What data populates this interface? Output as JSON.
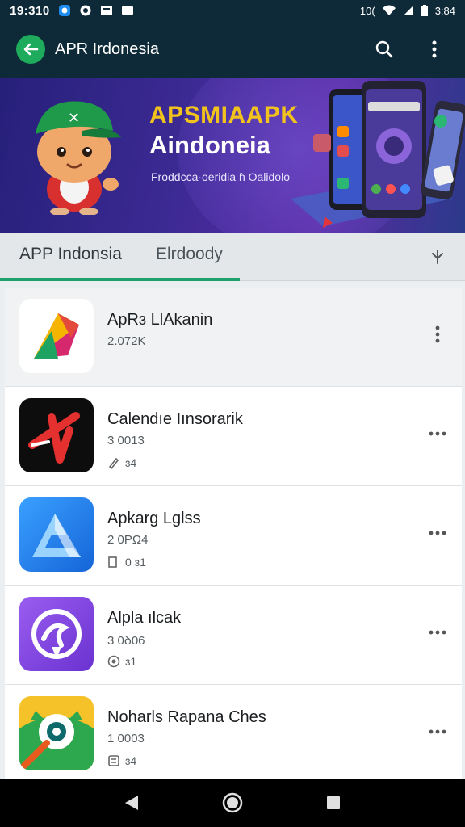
{
  "status_bar": {
    "time": "19:310",
    "signal_text": "10(",
    "battery_text": "3:84",
    "icons": [
      "notification-icon",
      "notification-icon",
      "message-icon",
      "square-icon",
      "wifi-icon",
      "signal-icon",
      "battery-icon"
    ]
  },
  "app_bar": {
    "title": "APR Irdonesia",
    "back_icon": "arrow-left-icon",
    "search_icon": "search-icon",
    "menu_icon": "more-vertical-icon",
    "accent": "#1fab5c",
    "background": "#0e2a38"
  },
  "banner": {
    "headline": "APSMIAAPK",
    "subheadline": "Aindoneia",
    "caption": "Froddcca·oeridia  ɦ Oalidolo",
    "headline_color": "#f2c31c"
  },
  "tabs": {
    "items": [
      {
        "label": "APP Indonsia",
        "selected": true
      },
      {
        "label": "Elrdoody",
        "selected": false
      }
    ],
    "more_icon": "sort-icon",
    "indicator_color": "#1fa06a"
  },
  "apps": [
    {
      "name": "ApRɜ LlAkanin",
      "size": "2.072K",
      "meta": "",
      "icon": "play-logo-icon",
      "more": "more-vertical-icon"
    },
    {
      "name": "Calendıe Iınsorarik",
      "size": "3 0013",
      "meta": "ɜ4",
      "meta_icon": "pencil-icon",
      "icon": "red-x-logo-icon",
      "more": "more-horizontal-icon"
    },
    {
      "name": "Apkarg Lglss",
      "size": "2 0PΩ4",
      "meta": "0 ɜ1",
      "meta_icon": "box-icon",
      "icon": "blue-a-logo-icon",
      "more": "more-horizontal-icon"
    },
    {
      "name": "Alpla ılcak",
      "size": "3 0ꝺ06",
      "meta": "ɜ1",
      "meta_icon": "target-icon",
      "icon": "purple-swirl-logo-icon",
      "more": "more-horizontal-icon"
    },
    {
      "name": "Noharls Rapana Ches",
      "size": "1 0003",
      "meta": "ɜ4",
      "meta_icon": "grid-icon",
      "icon": "green-owl-logo-icon",
      "more": "more-horizontal-icon"
    }
  ],
  "nav_bar": {
    "back_icon": "nav-back-icon",
    "home_icon": "nav-home-icon",
    "recents_icon": "nav-recents-icon"
  }
}
